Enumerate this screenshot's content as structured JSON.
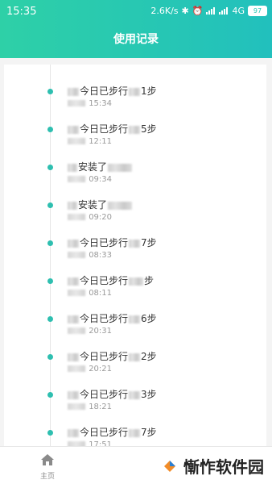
{
  "status_bar": {
    "time": "15:35",
    "net_speed": "2.6K/s",
    "network": "4G",
    "battery": "97"
  },
  "header": {
    "title": "使用记录"
  },
  "records": [
    {
      "text_a": "今日已步行",
      "text_b": "1步",
      "time": "15:34"
    },
    {
      "text_a": "今日已步行",
      "text_b": "5步",
      "time": "12:11"
    },
    {
      "text_a": "安装了",
      "text_b": "",
      "time": "09:34"
    },
    {
      "text_a": "安装了",
      "text_b": "",
      "time": "09:20"
    },
    {
      "text_a": "今日已步行",
      "text_b": "7步",
      "time": "08:33"
    },
    {
      "text_a": "今日已步行",
      "text_b": "步",
      "time": "08:11"
    },
    {
      "text_a": "今日已步行",
      "text_b": "6步",
      "time": "20:31"
    },
    {
      "text_a": "今日已步行",
      "text_b": "2步",
      "time": "20:21"
    },
    {
      "text_a": "今日已步行",
      "text_b": "3步",
      "time": "18:21"
    },
    {
      "text_a": "今日已步行",
      "text_b": "7步",
      "time": "17:51"
    }
  ],
  "bottom_nav": {
    "home_label": "主页",
    "home_icon": "home-icon"
  },
  "watermark": {
    "text": "慚怍软件园"
  },
  "colors": {
    "accent": "#2ebfb0",
    "header_start": "#2ed0a7",
    "header_end": "#22c0bd"
  }
}
